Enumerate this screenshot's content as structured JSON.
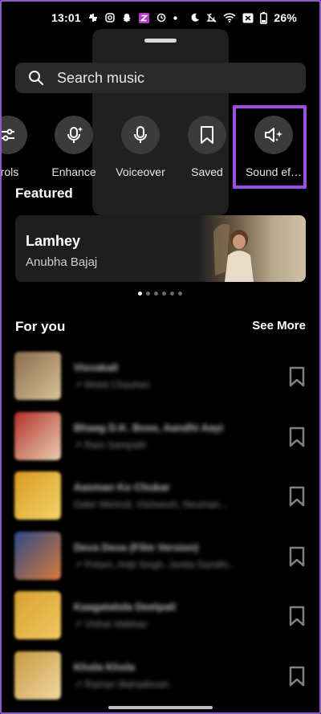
{
  "status_bar": {
    "time": "13:01",
    "battery": "26%"
  },
  "search": {
    "placeholder": "Search music"
  },
  "tools": [
    {
      "label": "trols",
      "icon": "controls-icon"
    },
    {
      "label": "Enhance",
      "icon": "enhance-icon"
    },
    {
      "label": "Voiceover",
      "icon": "microphone-icon"
    },
    {
      "label": "Saved",
      "icon": "bookmark-icon"
    },
    {
      "label": "Sound ef…",
      "icon": "sound-effects-icon"
    }
  ],
  "featured": {
    "title": "Featured",
    "card": {
      "song": "Lamhey",
      "artist": "Anubha Bajaj"
    },
    "pages": 6,
    "active_page": 0
  },
  "for_you": {
    "title": "For you",
    "see_more": "See More",
    "songs": [
      {
        "title": "Visvakali",
        "subtitle": "↗ Mohit Chauhan",
        "thumb": [
          "#8a6a4a",
          "#d8c49a"
        ]
      },
      {
        "title": "Bhaag D.K. Bose, Aandhi Aayi",
        "subtitle": "↗ Ram Sampath",
        "thumb": [
          "#b5302c",
          "#e8d0b0"
        ]
      },
      {
        "title": "Aasman Ko Chukar",
        "subtitle": "Daler Mehndi, Vishwesh, Neuman...",
        "thumb": [
          "#d89a20",
          "#f3d36a"
        ]
      },
      {
        "title": "Deva Deva (Film Version)",
        "subtitle": "↗ Pritam, Arijit Singh, Jonita Gandhi...",
        "thumb": [
          "#2c4a8a",
          "#d87a3a"
        ]
      },
      {
        "title": "Kaagatalola Deetpali",
        "subtitle": "↗ Vishal Vaibhav",
        "thumb": [
          "#d8a030",
          "#f0c860"
        ]
      },
      {
        "title": "Khola Khola",
        "subtitle": "↗ Raman Mahadevan",
        "thumb": [
          "#c89a40",
          "#efd8a0"
        ]
      }
    ]
  }
}
